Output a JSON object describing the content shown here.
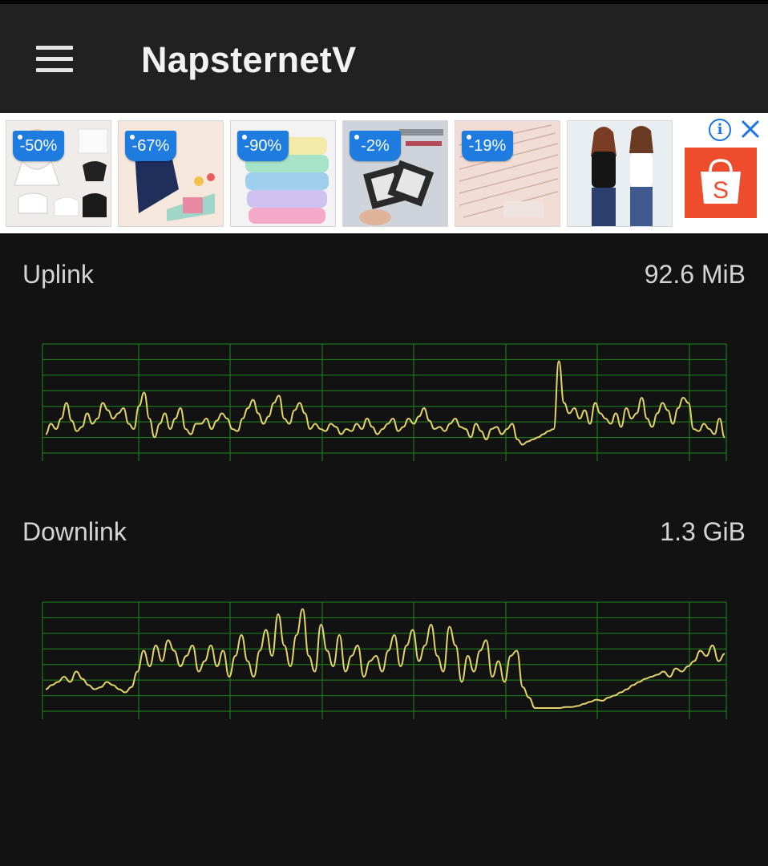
{
  "app": {
    "title": "NapsternetV"
  },
  "ad": {
    "tiles": [
      {
        "discount": "-50%"
      },
      {
        "discount": "-67%"
      },
      {
        "discount": "-90%"
      },
      {
        "discount": "-2%"
      },
      {
        "discount": "-19%"
      },
      {
        "discount": ""
      }
    ],
    "info_icon": "i",
    "brand_logo_letter": "S",
    "brand_color": "#ee4d2d"
  },
  "uplink": {
    "label": "Uplink",
    "value": "92.6 MiB"
  },
  "downlink": {
    "label": "Downlink",
    "value": "1.3 GiB"
  },
  "colors": {
    "background": "#121212",
    "appbar": "#212121",
    "grid": "#1e8a1e",
    "trace": "#e3d36a",
    "discount_tag": "#1e7be0"
  },
  "chart_data": [
    {
      "type": "line",
      "name": "Uplink",
      "grid": true,
      "values": [
        0.15,
        0.25,
        0.2,
        0.3,
        0.45,
        0.28,
        0.18,
        0.22,
        0.35,
        0.25,
        0.3,
        0.45,
        0.38,
        0.3,
        0.35,
        0.4,
        0.25,
        0.2,
        0.42,
        0.55,
        0.3,
        0.12,
        0.25,
        0.35,
        0.2,
        0.3,
        0.4,
        0.2,
        0.15,
        0.25,
        0.25,
        0.3,
        0.2,
        0.28,
        0.35,
        0.3,
        0.2,
        0.18,
        0.3,
        0.4,
        0.48,
        0.35,
        0.25,
        0.32,
        0.45,
        0.52,
        0.3,
        0.25,
        0.38,
        0.45,
        0.35,
        0.2,
        0.25,
        0.2,
        0.18,
        0.25,
        0.22,
        0.15,
        0.2,
        0.18,
        0.25,
        0.2,
        0.3,
        0.22,
        0.15,
        0.2,
        0.25,
        0.3,
        0.18,
        0.22,
        0.3,
        0.25,
        0.32,
        0.4,
        0.28,
        0.2,
        0.22,
        0.18,
        0.25,
        0.3,
        0.22,
        0.2,
        0.12,
        0.25,
        0.18,
        0.1,
        0.2,
        0.22,
        0.15,
        0.2,
        0.25,
        0.1,
        0.05,
        0.08,
        0.1,
        0.12,
        0.15,
        0.18,
        0.2,
        0.85,
        0.45,
        0.35,
        0.4,
        0.3,
        0.38,
        0.25,
        0.45,
        0.35,
        0.3,
        0.25,
        0.35,
        0.22,
        0.4,
        0.3,
        0.35,
        0.5,
        0.3,
        0.22,
        0.35,
        0.45,
        0.38,
        0.25,
        0.4,
        0.5,
        0.45,
        0.2,
        0.18,
        0.25,
        0.2,
        0.15,
        0.3,
        0.12
      ]
    },
    {
      "type": "line",
      "name": "Downlink",
      "grid": true,
      "values": [
        0.18,
        0.22,
        0.25,
        0.3,
        0.25,
        0.35,
        0.28,
        0.22,
        0.18,
        0.2,
        0.25,
        0.22,
        0.18,
        0.15,
        0.2,
        0.35,
        0.55,
        0.4,
        0.6,
        0.45,
        0.65,
        0.55,
        0.4,
        0.5,
        0.6,
        0.35,
        0.45,
        0.6,
        0.4,
        0.55,
        0.3,
        0.5,
        0.7,
        0.45,
        0.3,
        0.55,
        0.75,
        0.5,
        0.9,
        0.6,
        0.4,
        0.7,
        0.95,
        0.5,
        0.35,
        0.8,
        0.55,
        0.4,
        0.7,
        0.35,
        0.5,
        0.6,
        0.3,
        0.45,
        0.5,
        0.35,
        0.55,
        0.7,
        0.4,
        0.6,
        0.75,
        0.45,
        0.6,
        0.8,
        0.5,
        0.35,
        0.78,
        0.6,
        0.25,
        0.5,
        0.35,
        0.55,
        0.65,
        0.3,
        0.45,
        0.25,
        0.5,
        0.55,
        0.2,
        0.1,
        0.0,
        0.0,
        0.0,
        0.0,
        0.0,
        0.01,
        0.01,
        0.02,
        0.04,
        0.06,
        0.08,
        0.07,
        0.1,
        0.12,
        0.15,
        0.18,
        0.22,
        0.25,
        0.28,
        0.3,
        0.32,
        0.35,
        0.3,
        0.38,
        0.35,
        0.4,
        0.45,
        0.55,
        0.5,
        0.6,
        0.45,
        0.52
      ]
    }
  ]
}
